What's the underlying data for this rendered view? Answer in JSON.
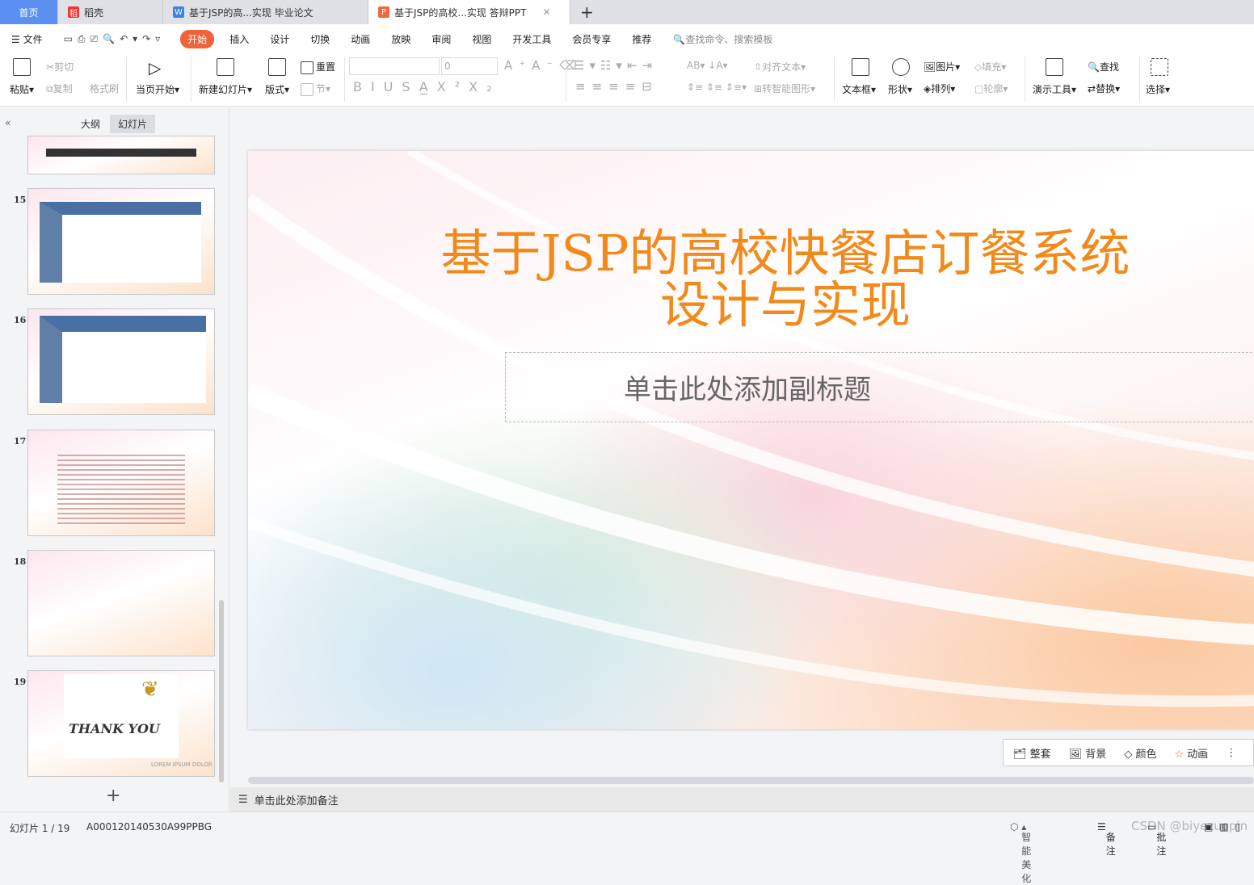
{
  "tabs": [
    {
      "label": "首页"
    },
    {
      "label": "稻壳",
      "icon": "docer-icon"
    },
    {
      "label": "基于JSP的高...实现 毕业论文",
      "icon": "word-icon"
    },
    {
      "label": "基于JSP的高校...实现 答辩PPT",
      "icon": "ppt-icon"
    }
  ],
  "menu": {
    "file": "文件",
    "items": [
      "开始",
      "插入",
      "设计",
      "切换",
      "动画",
      "放映",
      "审阅",
      "视图",
      "开发工具",
      "会员专享",
      "推荐"
    ],
    "search": "查找命令、搜索模板"
  },
  "ribbon": {
    "paste": "粘贴",
    "cut": "剪切",
    "copy": "复制",
    "format_painter": "格式刷",
    "play_current": "当页开始",
    "new_slide": "新建幻灯片",
    "layout": "版式",
    "reset": "重置",
    "section": "节",
    "font_size": "0",
    "align_text": "对齐文本",
    "smartart": "转智能图形",
    "textbox": "文本框",
    "shape": "形状",
    "picture": "图片",
    "arrange": "排列",
    "fill": "填充",
    "outline": "轮廓",
    "present_tools": "演示工具",
    "find": "查找",
    "replace": "替换",
    "select": "选择"
  },
  "panel": {
    "outline_tab": "大纲",
    "slides_tab": "幻灯片",
    "thumbs": [
      {
        "num": "15"
      },
      {
        "num": "16"
      },
      {
        "num": "17"
      },
      {
        "num": "18"
      },
      {
        "num": "19",
        "text": "THANK YOU",
        "footer": "LOREM IPSUM DOLOR"
      }
    ]
  },
  "slide": {
    "title_line1": "基于JSP的高校快餐店订餐系统",
    "title_line2": "设计与实现",
    "subtitle_placeholder": "单击此处添加副标题",
    "title_color": "#f28a1b"
  },
  "float_bar": {
    "set": "整套",
    "background": "背景",
    "color": "颜色",
    "animation": "动画"
  },
  "notes": "单击此处添加备注",
  "status": {
    "slide_count": "幻灯片 1 / 19",
    "template_id": "A000120140530A99PPBG",
    "beautify": "智能美化",
    "notes": "备注",
    "comment": "批注",
    "watermark": "CSDN @biyezuopin"
  }
}
